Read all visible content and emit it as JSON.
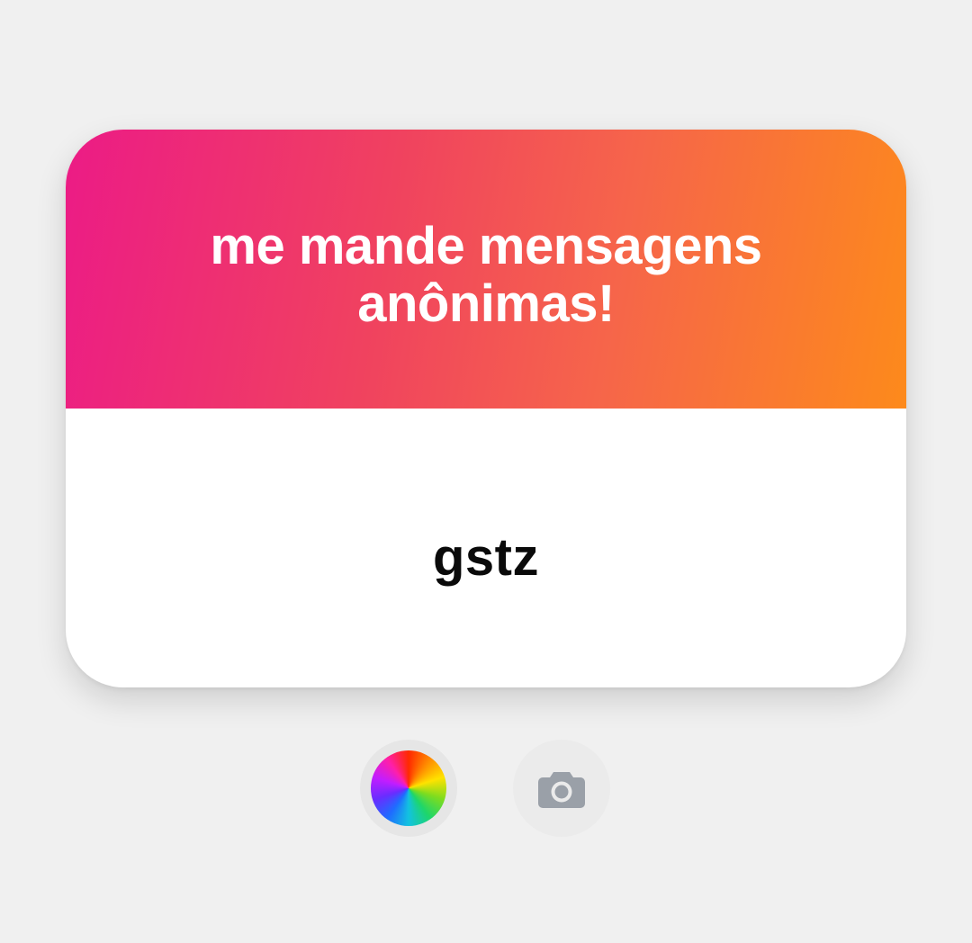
{
  "card": {
    "title": "me mande mensagens anônimas!",
    "username": "gstz"
  },
  "controls": {
    "color_button_icon": "color-wheel-icon",
    "camera_button_icon": "camera-icon"
  },
  "colors": {
    "background": "#f0f0f0",
    "gradient_start": "#ec1b86",
    "gradient_end": "#fd8a1b",
    "card_body": "#ffffff",
    "camera_icon": "#9aa0a8"
  }
}
